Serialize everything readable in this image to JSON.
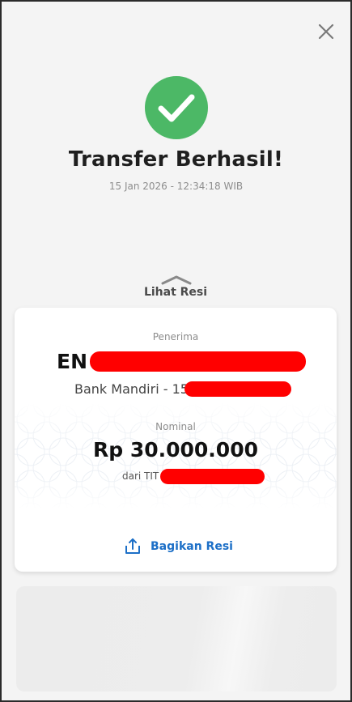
{
  "header": {
    "close_icon": "close-icon",
    "status_icon": "check-circle-icon",
    "title": "Transfer Berhasil!",
    "timestamp": "15 Jan 2026 - 12:34:18 WIB"
  },
  "receipt_toggle": {
    "label": "Lihat Resi",
    "icon": "chevron-up-icon"
  },
  "receipt": {
    "recipient_label": "Penerima",
    "recipient_name_visible": "EN",
    "bank_line_visible": "Bank Mandiri - 15",
    "amount_label": "Nominal",
    "amount": "Rp 30.000.000",
    "source_visible": "dari TIT",
    "share_label": "Bagikan Resi",
    "share_icon": "share-icon"
  },
  "colors": {
    "success_green": "#4cb866",
    "link_blue": "#1c6fc7",
    "redaction_red": "#ff0000"
  }
}
